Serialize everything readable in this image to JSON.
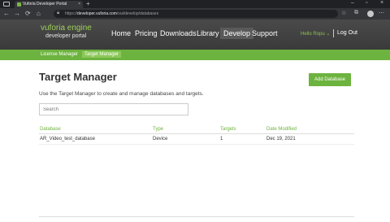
{
  "browser": {
    "tab_title": "Vuforia Developer Portal",
    "tab_close": "×",
    "new_tab": "+",
    "url_host": "developer.vuforia.com",
    "url_prefix": "https://",
    "url_path": "/vui/develop/databases",
    "window_controls": [
      "–",
      "▫",
      "×"
    ],
    "nav": [
      "←",
      "→",
      "⟳",
      "⌂"
    ]
  },
  "site": {
    "logo_line1": "vuforia engine",
    "logo_line2": "developer portal",
    "nav": [
      "Home",
      "Pricing",
      "Downloads",
      "Library",
      "Develop",
      "Support"
    ],
    "user_greeting": "Hello Ropu ⌄",
    "logout": "Log Out",
    "subnav": [
      "License Manager",
      "Target Manager"
    ]
  },
  "main": {
    "title": "Target Manager",
    "add_button": "Add Database",
    "intro": "Use the Target Manager to create and manage databases and targets.",
    "search_placeholder": "Search",
    "columns": [
      "Database",
      "Type",
      "Targets",
      "Date Modified"
    ],
    "rows": [
      [
        "AR_Video_test_database",
        "Device",
        "1",
        "Dec 19, 2021"
      ]
    ]
  },
  "colors": {
    "accent": "#6db33f",
    "header_bg": "#404040",
    "chrome_bg": "#35363a"
  }
}
